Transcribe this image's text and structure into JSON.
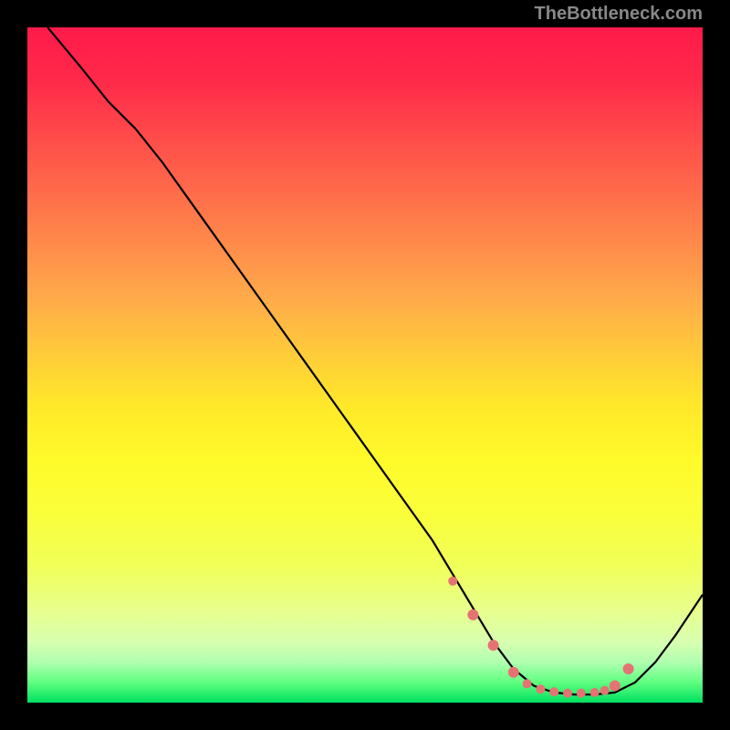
{
  "watermark": "TheBottleneck.com",
  "chart_data": {
    "type": "line",
    "title": "",
    "xlabel": "",
    "ylabel": "",
    "xlim": [
      0,
      100
    ],
    "ylim": [
      0,
      100
    ],
    "series": [
      {
        "name": "curve",
        "x": [
          3,
          8,
          12,
          16,
          20,
          25,
          30,
          35,
          40,
          45,
          50,
          55,
          60,
          63,
          66,
          69,
          72,
          75,
          78,
          81,
          84,
          87,
          90,
          93,
          96,
          100
        ],
        "y": [
          100,
          94,
          89,
          85,
          80,
          73,
          66,
          59,
          52,
          45,
          38,
          31,
          24,
          19,
          14,
          9,
          5,
          2.5,
          1.5,
          1.2,
          1.2,
          1.5,
          3,
          6,
          10,
          16
        ]
      }
    ],
    "markers": {
      "name": "highlighted-points",
      "x": [
        63,
        66,
        69,
        72,
        74,
        76,
        78,
        80,
        82,
        84,
        85.5,
        87,
        89
      ],
      "y": [
        18,
        13,
        8.5,
        4.5,
        2.8,
        2.0,
        1.6,
        1.4,
        1.4,
        1.5,
        1.8,
        2.5,
        5.0
      ],
      "size": [
        5,
        6,
        6,
        6,
        5,
        5,
        5,
        5,
        5,
        5,
        5,
        6,
        6
      ]
    }
  }
}
